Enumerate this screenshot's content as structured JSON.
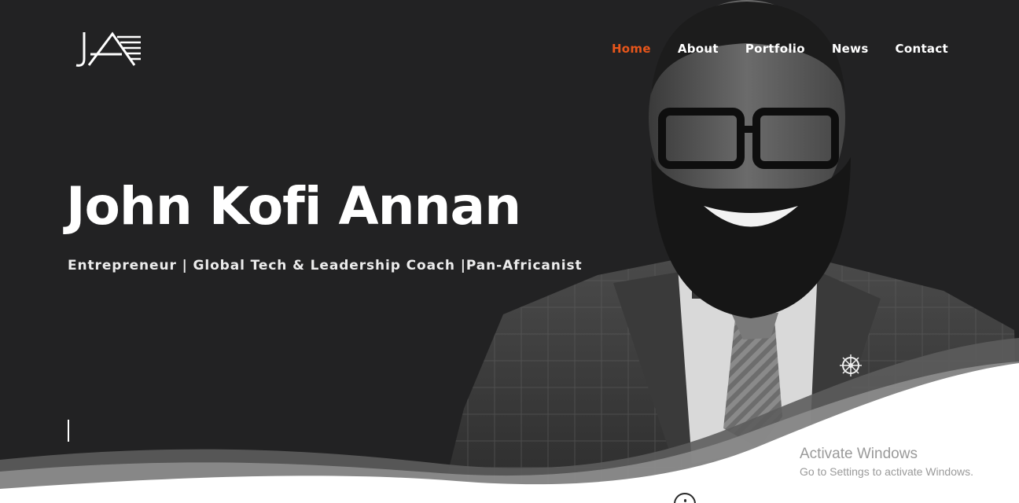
{
  "logo": {
    "text": "JKA"
  },
  "nav": {
    "items": [
      {
        "label": "Home",
        "active": true
      },
      {
        "label": "About",
        "active": false
      },
      {
        "label": "Portfolio",
        "active": false
      },
      {
        "label": "News",
        "active": false
      },
      {
        "label": "Contact",
        "active": false
      }
    ]
  },
  "hero": {
    "title": "John Kofi Annan",
    "subtitle": "Entrepreneur | Global Tech & Leadership Coach |Pan-Africanist"
  },
  "watermark": {
    "line1": "Activate Windows",
    "line2": "Go to Settings to activate Windows."
  },
  "colors": {
    "background": "#222223",
    "accent": "#e8561b",
    "text": "#ffffff"
  },
  "icons": {
    "scroll": "scroll-down-icon",
    "lapel_pin": "compass-icon"
  }
}
